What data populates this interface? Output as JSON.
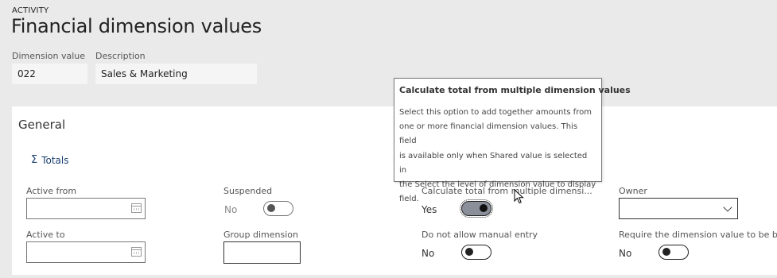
{
  "header": {
    "activity": "ACTIVITY",
    "title": "Financial dimension values"
  },
  "summary": {
    "dimension_value_label": "Dimension value",
    "dimension_value": "022",
    "description_label": "Description",
    "description": "Sales & Marketing"
  },
  "general": {
    "title": "General",
    "totals_icon": "sigma-icon",
    "totals_label": "Totals",
    "active_from_label": "Active from",
    "active_from_value": "",
    "active_to_label": "Active to",
    "active_to_value": "",
    "suspended_label": "Suspended",
    "suspended_value": "No",
    "group_dimension_label": "Group dimension",
    "group_dimension_value": "",
    "calc_total_label": "Calculate total from multiple dimensi...",
    "calc_total_value": "Yes",
    "no_manual_entry_label": "Do not allow manual entry",
    "no_manual_entry_value": "No",
    "owner_label": "Owner",
    "owner_value": "",
    "require_label": "Require the dimension value to be ba...",
    "require_value": "No"
  },
  "tooltip": {
    "title": "Calculate total from multiple dimension values",
    "lines": [
      "Select this option to add together amounts from",
      "one or more financial dimension values. This field",
      "is available only when Shared value is selected in",
      "the Select the level of dimension value to display",
      "field."
    ]
  },
  "colors": {
    "background": "#eaeaea",
    "card": "#ffffff",
    "link": "#1a3f6f",
    "toggle_on": "#8a8f99"
  }
}
